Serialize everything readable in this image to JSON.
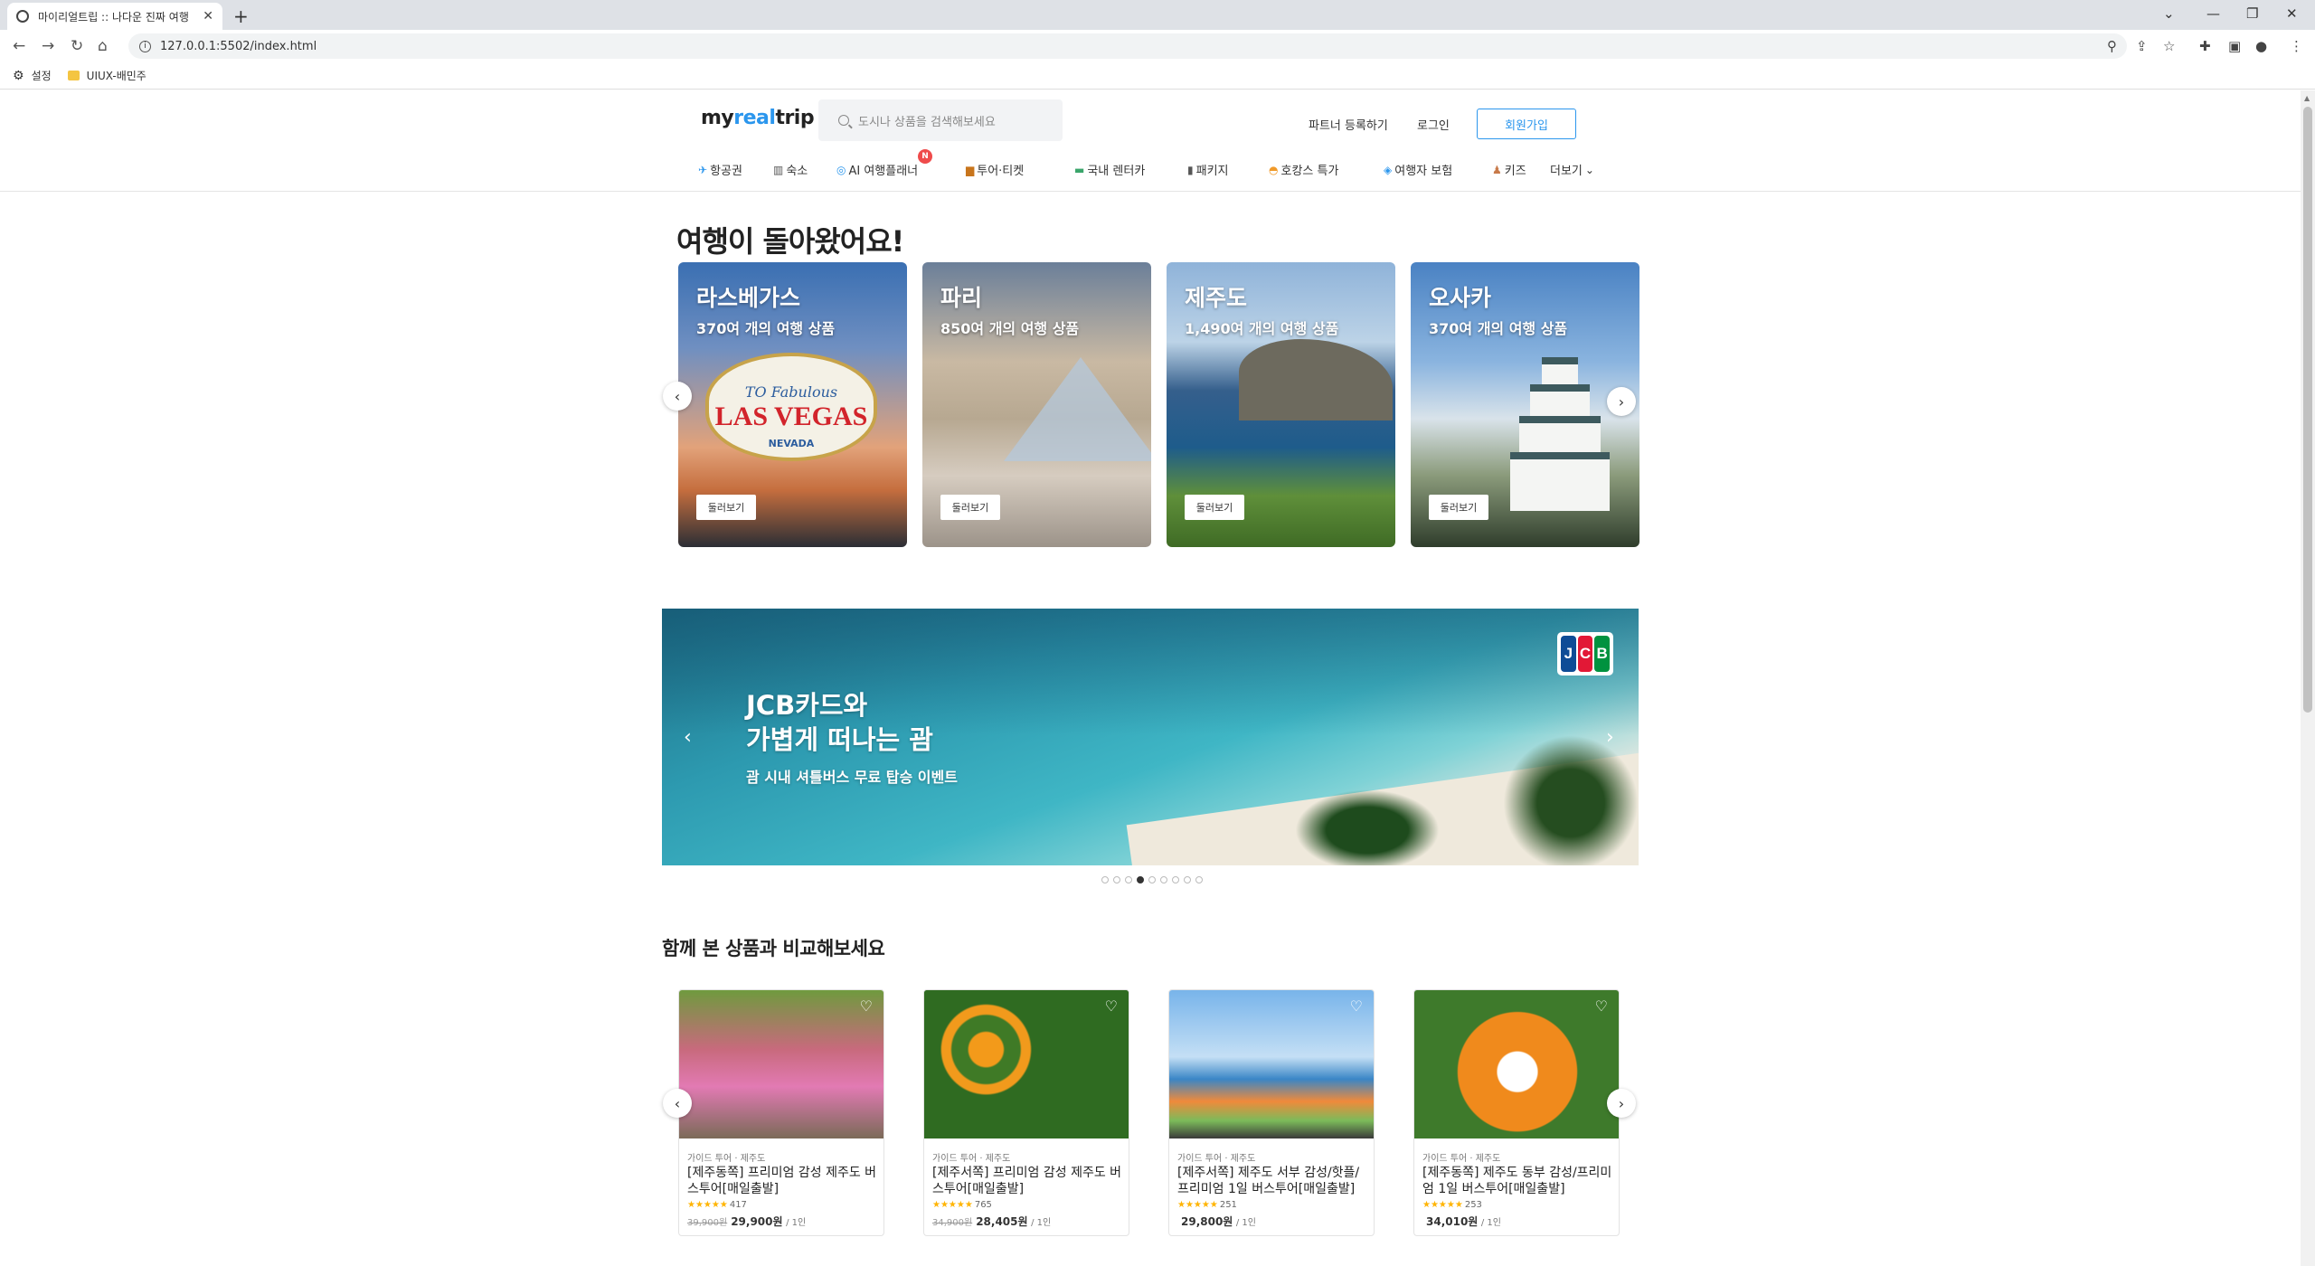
{
  "browser": {
    "tab_title": "마이리얼트립 :: 나다운 진짜 여행",
    "tab_close": "✕",
    "new_tab": "+",
    "url": "127.0.0.1:5502/index.html",
    "bookmarks": [
      {
        "label": "설정",
        "icon": "gear-icon"
      },
      {
        "label": "UIUX-배민주",
        "icon": "folder-icon"
      }
    ]
  },
  "header": {
    "logo_a": "my",
    "logo_b": "real",
    "logo_c": "trip",
    "search_placeholder": "도시나 상품을 검색해보세요",
    "partner_link": "파트너 등록하기",
    "login_link": "로그인",
    "signup_button": "회원가입",
    "nav": [
      {
        "label": "항공권",
        "icon": "airplane-icon"
      },
      {
        "label": "숙소",
        "icon": "hotel-icon"
      },
      {
        "label": "AI 여행플래너",
        "icon": "ai-icon",
        "badge": "N"
      },
      {
        "label": "투어·티켓",
        "icon": "ticket-icon"
      },
      {
        "label": "국내 렌터카",
        "icon": "car-icon"
      },
      {
        "label": "패키지",
        "icon": "luggage-icon"
      },
      {
        "label": "호캉스 특가",
        "icon": "sunset-icon"
      },
      {
        "label": "여행자 보험",
        "icon": "insurance-icon"
      },
      {
        "label": "키즈",
        "icon": "kids-icon"
      },
      {
        "label": "더보기",
        "icon": "chevron-down-icon"
      }
    ]
  },
  "hero": {
    "title": "여행이 돌아왔어요!",
    "browse_label": "둘러보기",
    "cards": [
      {
        "city": "라스베가스",
        "count": "370여 개의 여행 상품"
      },
      {
        "city": "파리",
        "count": "850여 개의 여행 상품"
      },
      {
        "city": "제주도",
        "count": "1,490여 개의 여행 상품"
      },
      {
        "city": "오사카",
        "count": "370여 개의 여행 상품"
      }
    ],
    "vegas_sign": {
      "line1": "TO Fabulous",
      "line2": "LAS VEGAS",
      "line3": "NEVADA"
    }
  },
  "banner": {
    "title_line1": "JCB카드와",
    "title_line2": "가볍게 떠나는 괌",
    "subtitle": "괌 시내 셔틀버스 무료 탑승 이벤트",
    "logo_letters": [
      "J",
      "C",
      "B"
    ],
    "logo_colors": [
      "#0e4c96",
      "#e21836",
      "#00923f"
    ],
    "dot_count": 9,
    "active_dot": 4
  },
  "compare": {
    "title": "함께 본 상품과 비교해보세요",
    "products": [
      {
        "category": "가이드 투어 · 제주도",
        "title": "[제주동쪽] 프리미엄 감성 제주도 버스투어[매일출발]",
        "stars": "★★★★★",
        "reviews": "417",
        "old_price": "39,900원",
        "price": "29,900원",
        "unit": "/ 1인"
      },
      {
        "category": "가이드 투어 · 제주도",
        "title": "[제주서쪽] 프리미엄 감성 제주도 버스투어[매일출발]",
        "stars": "★★★★★",
        "reviews": "765",
        "old_price": "34,900원",
        "price": "28,405원",
        "unit": "/ 1인"
      },
      {
        "category": "가이드 투어 · 제주도",
        "title": "[제주서쪽] 제주도 서부 감성/핫플/프리미엄 1일 버스투어[매일출발]",
        "stars": "★★★★★",
        "reviews": "251",
        "old_price": "",
        "price": "29,800원",
        "unit": "/ 1인"
      },
      {
        "category": "가이드 투어 · 제주도",
        "title": "[제주동쪽] 제주도 동부 감성/프리미엄 1일 버스투어[매일출발]",
        "stars": "★★★★★",
        "reviews": "253",
        "old_price": "",
        "price": "34,010원",
        "unit": "/ 1인"
      }
    ]
  }
}
